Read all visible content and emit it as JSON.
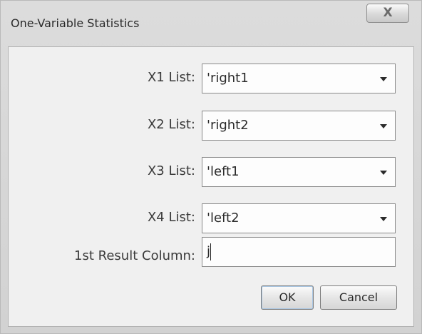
{
  "window": {
    "title": "One-Variable Statistics",
    "close_glyph": "X"
  },
  "fields": [
    {
      "label": "X1 List:",
      "value": "'right1"
    },
    {
      "label": "X2 List:",
      "value": "'right2"
    },
    {
      "label": "X3 List:",
      "value": "'left1"
    },
    {
      "label": "X4 List:",
      "value": "'left2"
    }
  ],
  "result_column": {
    "label": "1st Result Column:",
    "value": "j"
  },
  "buttons": {
    "ok": "OK",
    "cancel": "Cancel"
  },
  "icons": {
    "close": "close-icon",
    "dropdown": "chevron-down-icon"
  }
}
